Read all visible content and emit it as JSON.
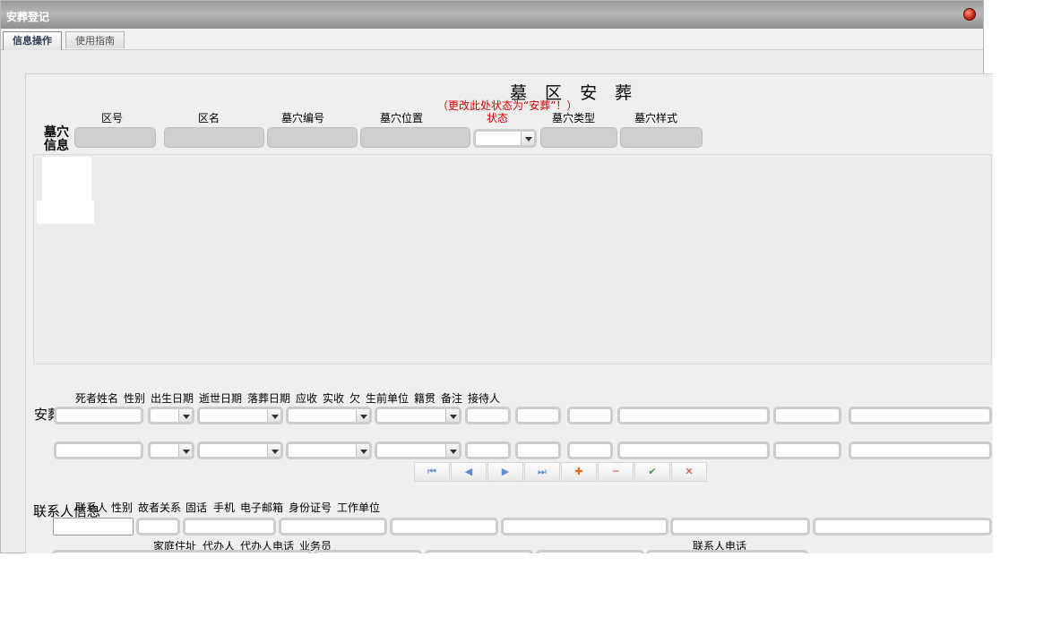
{
  "window": {
    "title": "安葬登记"
  },
  "tabs": [
    {
      "label": "信息操作",
      "active": true
    },
    {
      "label": "使用指南",
      "active": false
    }
  ],
  "header": {
    "title": "墓 区 安 葬",
    "note": "（更改此处状态为“安葬”！）"
  },
  "grave_section": {
    "label_line1": "墓穴",
    "label_line2": "信息",
    "columns": [
      "区号",
      "区名",
      "墓穴编号",
      "墓穴位置",
      "状态",
      "墓穴类型",
      "墓穴样式"
    ]
  },
  "burial_section": {
    "label": "安葬信息",
    "columns": [
      "死者姓名",
      "性别",
      "出生日期",
      "逝世日期",
      "落葬日期",
      "应收",
      "实收",
      "欠",
      "生前单位",
      "籍贯",
      "备注",
      "接待人"
    ]
  },
  "toolbar": {
    "first": "⏮",
    "prev": "◀",
    "next": "▶",
    "last": "⏭",
    "add": "✚",
    "remove": "━",
    "confirm": "✔",
    "cancel": "✕"
  },
  "contact_section": {
    "label": "联系人信息",
    "columns": [
      "联系人",
      "性别",
      "故者关系",
      "固话",
      "手机",
      "电子邮箱",
      "身份证号",
      "工作单位"
    ],
    "columns2": [
      "家庭住址",
      "代办人",
      "代办人电话",
      "业务员"
    ],
    "extra_label": "联系人电话"
  },
  "colors": {
    "accent_red": "#d40000",
    "title_text": "#ffffff"
  }
}
